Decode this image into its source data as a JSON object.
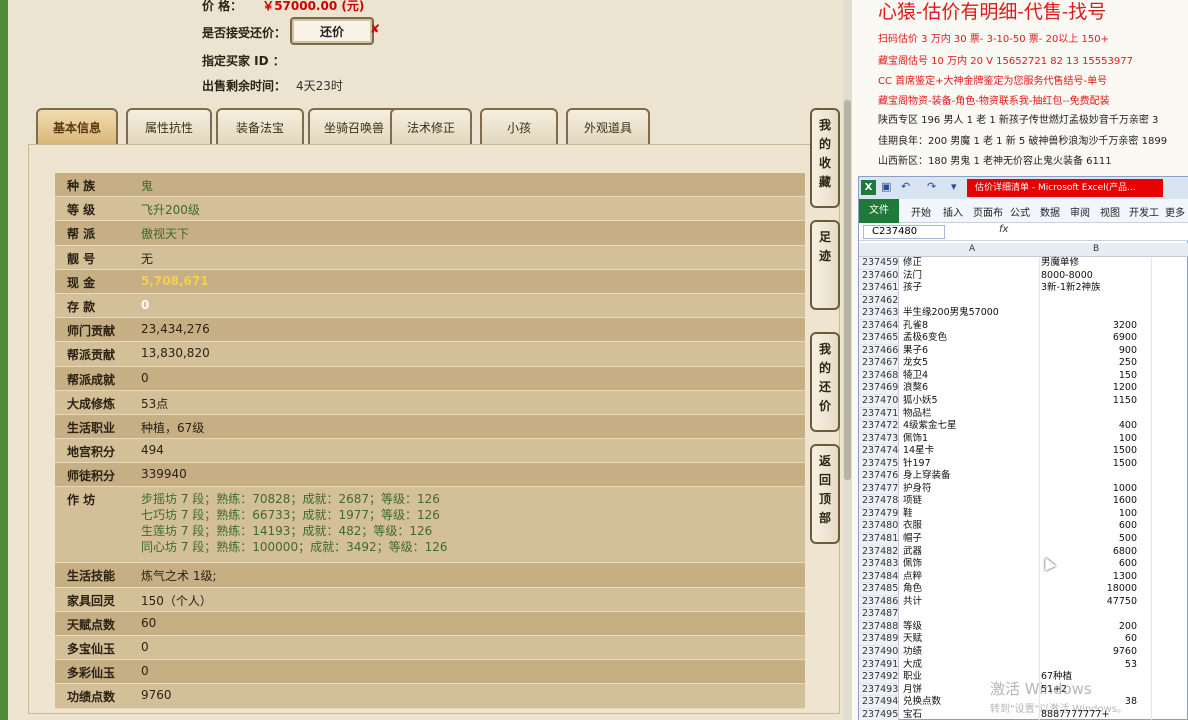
{
  "game": {
    "price_label": "价        格：",
    "price_value": "￥57000.00 (元)",
    "counter_label": "是否接受还价：",
    "counter_button": "还价",
    "counter_mark": "✘",
    "buyer_label": "指定买家 ID ：",
    "time_label": "出售剩余时间：",
    "time_value": "4天23时",
    "tabs": [
      "基本信息",
      "属性抗性",
      "装备法宝",
      "坐骑召唤兽",
      "法术修正",
      "小孩",
      "外观道具"
    ],
    "rows": [
      {
        "k": "种    族",
        "v": "鬼",
        "style": "green"
      },
      {
        "k": "等    级",
        "v": "飞升200级",
        "style": "green"
      },
      {
        "k": "帮    派",
        "v": "傲视天下",
        "style": "green"
      },
      {
        "k": "靓    号",
        "v": "无",
        "style": ""
      },
      {
        "k": "现    金",
        "v": "5,708,671",
        "style": "yellow"
      },
      {
        "k": "存    款",
        "v": "0",
        "style": "white"
      },
      {
        "k": "师门贡献",
        "v": "23,434,276",
        "style": ""
      },
      {
        "k": "帮派贡献",
        "v": "13,830,820",
        "style": ""
      },
      {
        "k": "帮派成就",
        "v": "0",
        "style": ""
      },
      {
        "k": "大成修炼",
        "v": "53点",
        "style": ""
      },
      {
        "k": "生活职业",
        "v": "种植，67级",
        "style": ""
      },
      {
        "k": "地宫积分",
        "v": "494",
        "style": ""
      },
      {
        "k": "师徒积分",
        "v": "339940",
        "style": ""
      }
    ],
    "workshop": {
      "k": "作    坊",
      "lines": [
        "步摇坊 7 段；熟练：70828；成就：2687；等级：126",
        "七巧坊 7 段；熟练：66733；成就：1977；等级：126",
        "生莲坊 7 段；熟练：14193；成就：482；等级：126",
        "同心坊 7 段；熟练：100000；成就：3492；等级：126"
      ]
    },
    "rows2": [
      {
        "k": "生活技能",
        "v": "炼气之术 1级;"
      },
      {
        "k": "家具回灵",
        "v": "150（个人）"
      },
      {
        "k": "天赋点数",
        "v": "60"
      },
      {
        "k": "多宝仙玉",
        "v": "0"
      },
      {
        "k": "多彩仙玉",
        "v": "0"
      },
      {
        "k": "功绩点数",
        "v": "9760"
      }
    ],
    "side_buttons": [
      "我的收藏",
      "足迹",
      "我的还价",
      "返回顶部"
    ]
  },
  "right": {
    "title": "心猿-估价有明细-代售-找号",
    "lines": [
      {
        "t": "扫码估价 3 万内 30 票- 3-10-50 票- 20以上 150+",
        "c": "#e01919"
      },
      {
        "t": "藏宝阁估号 10 万内 20 V 15652721 82 13 15553977",
        "c": "#e01919"
      },
      {
        "t": "CC 首席鉴定+大神金牌鉴定为您服务代售结号-单号",
        "c": "#e01919"
      },
      {
        "t": "藏宝阁物资-装备-角色-物资联系我-抽红包--免费配装",
        "c": "#e01919"
      },
      {
        "t": "陕西专区 196 男人 1 老 1 新孩子传世燃灯孟极妙音千万亲密 3",
        "c": "#222"
      },
      {
        "t": "佳期良年：200 男魔 1 老 1 新 5 破神兽秒浪淘沙千万亲密 1899",
        "c": "#222"
      },
      {
        "t": "山西新区：180 男鬼 1 老神无价容止鬼火装备 6111",
        "c": "#222"
      }
    ]
  },
  "excel": {
    "title": "估价详细清单 - Microsoft Excel(产品...",
    "ribbon_tabs": [
      "文件",
      "开始",
      "插入",
      "页面布",
      "公式",
      "数据",
      "审阅",
      "视图",
      "开发工",
      "更多"
    ],
    "namebox": "C237480",
    "fx": "fx",
    "col_a": "A",
    "col_b": "B",
    "rows": [
      {
        "n": "237459",
        "a": "修正",
        "b": "男魔单修",
        "num": false
      },
      {
        "n": "237460",
        "a": "法门",
        "b": "8000-8000",
        "num": false
      },
      {
        "n": "237461",
        "a": "孩子",
        "b": "3新-1新2神族",
        "num": false
      },
      {
        "n": "237462",
        "a": "",
        "b": "",
        "num": false
      },
      {
        "n": "237463",
        "a": "半生缘200男鬼57000",
        "b": "",
        "num": false
      },
      {
        "n": "237464",
        "a": "孔雀8",
        "b": "3200",
        "num": true
      },
      {
        "n": "237465",
        "a": "孟极6变色",
        "b": "6900",
        "num": true
      },
      {
        "n": "237466",
        "a": "果子6",
        "b": "900",
        "num": true
      },
      {
        "n": "237467",
        "a": "龙女5",
        "b": "250",
        "num": true
      },
      {
        "n": "237468",
        "a": "犄卫4",
        "b": "150",
        "num": true
      },
      {
        "n": "237469",
        "a": "浪獒6",
        "b": "1200",
        "num": true
      },
      {
        "n": "237470",
        "a": "狐小妖5",
        "b": "1150",
        "num": true
      },
      {
        "n": "237471",
        "a": "物品栏",
        "b": "",
        "num": false
      },
      {
        "n": "237472",
        "a": "4级紫金七星",
        "b": "400",
        "num": true
      },
      {
        "n": "237473",
        "a": "佩饰1",
        "b": "100",
        "num": true
      },
      {
        "n": "237474",
        "a": "14星卡",
        "b": "1500",
        "num": true
      },
      {
        "n": "237475",
        "a": "针197",
        "b": "1500",
        "num": true
      },
      {
        "n": "237476",
        "a": "身上穿装备",
        "b": "",
        "num": false
      },
      {
        "n": "237477",
        "a": "护身符",
        "b": "1000",
        "num": true
      },
      {
        "n": "237478",
        "a": "项链",
        "b": "1600",
        "num": true
      },
      {
        "n": "237479",
        "a": "鞋",
        "b": "100",
        "num": true
      },
      {
        "n": "237480",
        "a": "衣服",
        "b": "600",
        "num": true
      },
      {
        "n": "237481",
        "a": "帽子",
        "b": "500",
        "num": true
      },
      {
        "n": "237482",
        "a": "武器",
        "b": "6800",
        "num": true
      },
      {
        "n": "237483",
        "a": "佩饰",
        "b": "600",
        "num": true
      },
      {
        "n": "237484",
        "a": "点粹",
        "b": "1300",
        "num": true
      },
      {
        "n": "237485",
        "a": "角色",
        "b": "18000",
        "num": true
      },
      {
        "n": "237486",
        "a": "共计",
        "b": "47750",
        "num": true
      },
      {
        "n": "237487",
        "a": "",
        "b": "",
        "num": false
      },
      {
        "n": "237488",
        "a": "等级",
        "b": "200",
        "num": true
      },
      {
        "n": "237489",
        "a": "天赋",
        "b": "60",
        "num": true
      },
      {
        "n": "237490",
        "a": "功绩",
        "b": "9760",
        "num": true
      },
      {
        "n": "237491",
        "a": "大成",
        "b": "53",
        "num": true
      },
      {
        "n": "237492",
        "a": "职业",
        "b": "67种植",
        "num": false
      },
      {
        "n": "237493",
        "a": "月饼",
        "b": "51+2",
        "num": false
      },
      {
        "n": "237494",
        "a": "兑换点数",
        "b": "38",
        "num": true
      },
      {
        "n": "237495",
        "a": "宝石",
        "b": "8887777777+",
        "num": false
      }
    ]
  },
  "watermark": {
    "line1": "激活 Windows",
    "line2": "转到\"设置\"以激活 Windows。"
  }
}
